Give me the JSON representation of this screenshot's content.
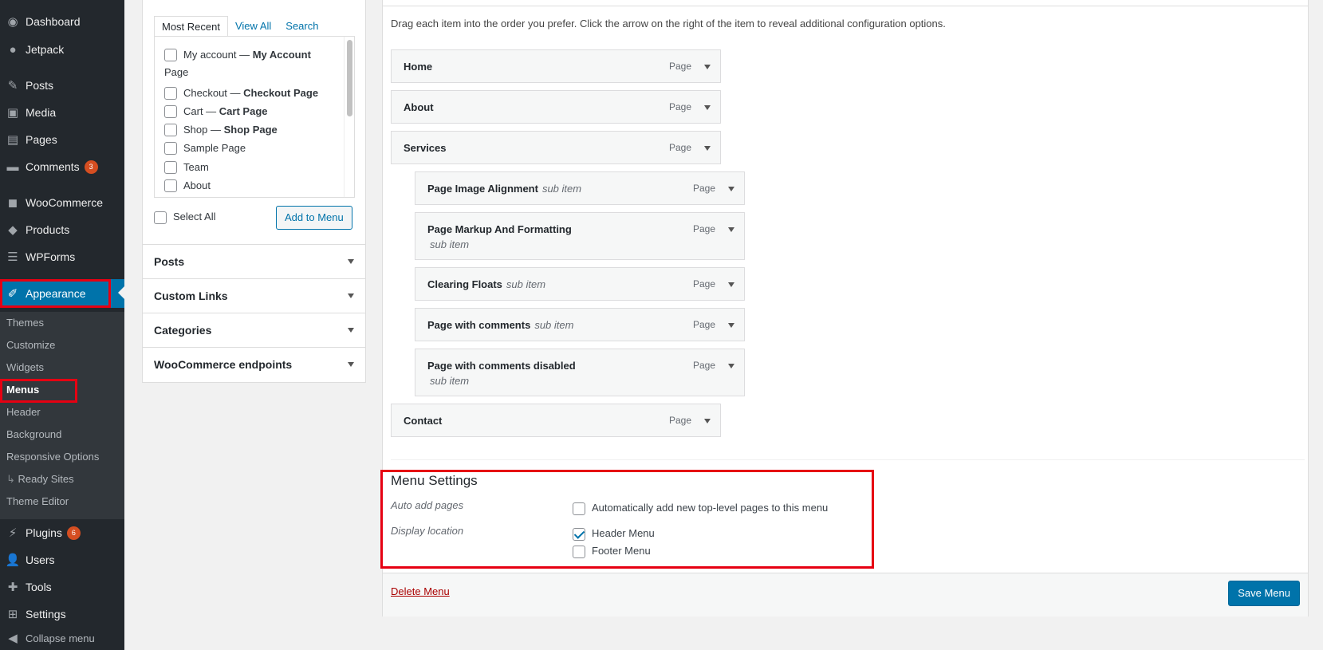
{
  "sidebar": {
    "items": [
      {
        "label": "Dashboard",
        "icon": "dashboard-icon"
      },
      {
        "label": "Jetpack",
        "icon": "jetpack-icon"
      },
      {
        "label": "Posts",
        "icon": "pin-icon"
      },
      {
        "label": "Media",
        "icon": "media-icon"
      },
      {
        "label": "Pages",
        "icon": "pages-icon"
      },
      {
        "label": "Comments",
        "icon": "comment-icon",
        "badge": "3"
      },
      {
        "label": "WooCommerce",
        "icon": "woocommerce-icon"
      },
      {
        "label": "Products",
        "icon": "products-icon"
      },
      {
        "label": "WPForms",
        "icon": "forms-icon"
      },
      {
        "label": "Appearance",
        "icon": "paintbrush-icon"
      },
      {
        "label": "Plugins",
        "icon": "plugin-icon",
        "badge": "6"
      },
      {
        "label": "Users",
        "icon": "user-icon"
      },
      {
        "label": "Tools",
        "icon": "wrench-icon"
      },
      {
        "label": "Settings",
        "icon": "settings-icon"
      },
      {
        "label": "Collapse menu",
        "icon": "collapse-icon"
      }
    ],
    "submenu": [
      "Themes",
      "Customize",
      "Widgets",
      "Menus",
      "Header",
      "Background",
      "Responsive Options",
      "Ready Sites",
      "Theme Editor"
    ],
    "submenu_child_arrow": "↳",
    "accent": "#0073aa",
    "highlight": "#e60012"
  },
  "pages_box": {
    "tabs": [
      "Most Recent",
      "View All",
      "Search"
    ],
    "items": [
      {
        "name": "My account — ",
        "bold": "My Account",
        "suffix": "Page"
      },
      {
        "name": "Checkout — ",
        "bold": "Checkout Page"
      },
      {
        "name": "Cart — ",
        "bold": "Cart Page"
      },
      {
        "name": "Shop — ",
        "bold": "Shop Page"
      },
      {
        "name": "Sample Page"
      },
      {
        "name": "Team"
      },
      {
        "name": "About"
      }
    ],
    "select_all": "Select All",
    "add_button": "Add to Menu"
  },
  "accordions": [
    "Posts",
    "Custom Links",
    "Categories",
    "WooCommerce endpoints"
  ],
  "menu": {
    "instructions": "Drag each item into the order you prefer. Click the arrow on the right of the item to reveal additional configuration options.",
    "items": [
      {
        "title": "Home",
        "type": "Page"
      },
      {
        "title": "About",
        "type": "Page"
      },
      {
        "title": "Services",
        "type": "Page"
      },
      {
        "title": "Page Image Alignment",
        "sub": "sub item",
        "type": "Page"
      },
      {
        "title": "Page Markup And Formatting",
        "sub": "sub item",
        "type": "Page"
      },
      {
        "title": "Clearing Floats",
        "sub": "sub item",
        "type": "Page"
      },
      {
        "title": "Page with comments",
        "sub": "sub item",
        "type": "Page"
      },
      {
        "title": "Page with comments disabled",
        "sub": "sub item",
        "type": "Page"
      },
      {
        "title": "Contact",
        "type": "Page"
      }
    ]
  },
  "menu_settings": {
    "title": "Menu Settings",
    "auto_add_label": "Auto add pages",
    "auto_add_option": "Automatically add new top-level pages to this menu",
    "display_location_label": "Display location",
    "locations": [
      {
        "label": "Header Menu",
        "checked": true
      },
      {
        "label": "Footer Menu",
        "checked": false
      }
    ]
  },
  "actions": {
    "delete": "Delete Menu",
    "save": "Save Menu"
  }
}
